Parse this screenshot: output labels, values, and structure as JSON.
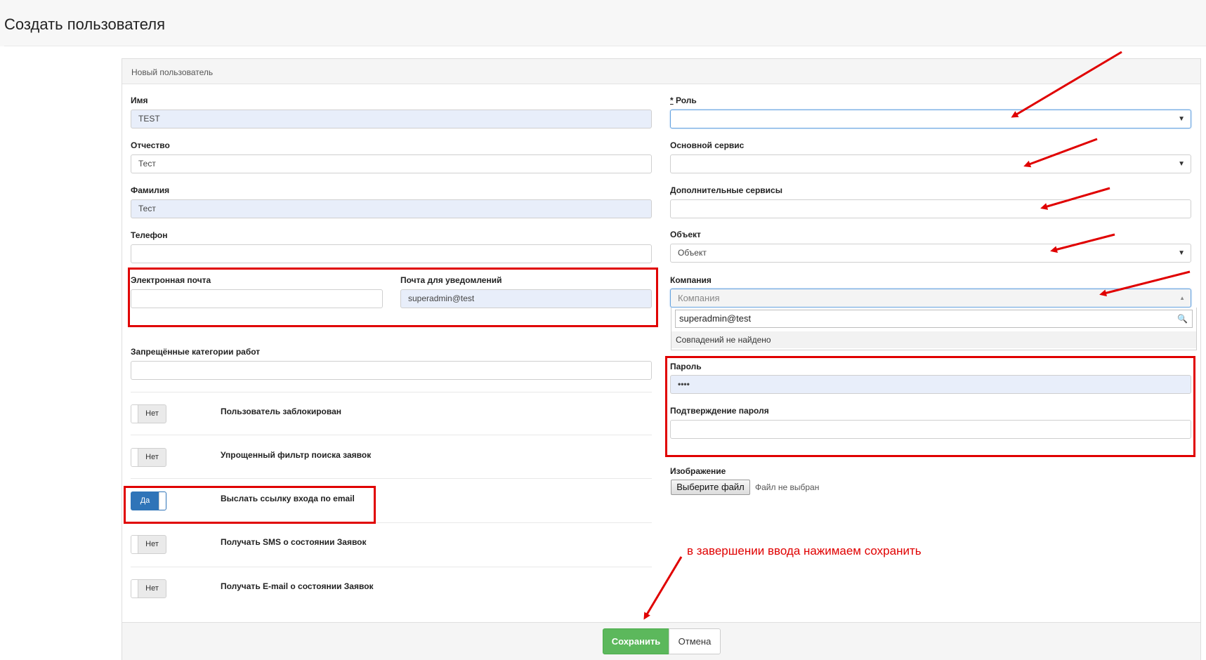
{
  "page": {
    "title": "Создать пользователя"
  },
  "panel": {
    "heading": "Новый пользователь"
  },
  "left": {
    "first_name": {
      "label": "Имя",
      "value": "TEST"
    },
    "middle_name": {
      "label": "Отчество",
      "value": "Тест"
    },
    "last_name": {
      "label": "Фамилия",
      "value": "Тест"
    },
    "phone": {
      "label": "Телефон",
      "value": ""
    },
    "email": {
      "label": "Электронная почта",
      "value": ""
    },
    "notify_email": {
      "label": "Почта для уведомлений",
      "value": "superadmin@test"
    },
    "forbidden_categories": {
      "label": "Запрещённые категории работ",
      "value": ""
    }
  },
  "toggles": [
    {
      "state": "Нет",
      "on": false,
      "label": "Пользователь заблокирован"
    },
    {
      "state": "Нет",
      "on": false,
      "label": "Упрощенный фильтр поиска заявок"
    },
    {
      "state": "Да",
      "on": true,
      "label": "Выслать ссылку входа по email"
    },
    {
      "state": "Нет",
      "on": false,
      "label": "Получать SMS о состоянии Заявок"
    },
    {
      "state": "Нет",
      "on": false,
      "label": "Получать E-mail о состоянии Заявок"
    }
  ],
  "right": {
    "role": {
      "required_mark": "*",
      "label": "Роль",
      "value": ""
    },
    "main_service": {
      "label": "Основной сервис",
      "value": ""
    },
    "extra_services": {
      "label": "Дополнительные сервисы",
      "value": ""
    },
    "object": {
      "label": "Объект",
      "placeholder": "Объект"
    },
    "company": {
      "label": "Компания",
      "placeholder": "Компания",
      "search_value": "superadmin@test",
      "no_results": "Совпадений не найдено"
    },
    "password": {
      "label": "Пароль",
      "value": "••••"
    },
    "password_confirm": {
      "label": "Подтверждение пароля",
      "value": ""
    },
    "image": {
      "label": "Изображение",
      "button": "Выберите файл",
      "status": "Файл не выбран"
    }
  },
  "icons": {
    "caret": "▼",
    "caret_up": "▲",
    "search": "🔍"
  },
  "annotation": {
    "text": "в завершении ввода нажимаем сохранить",
    "color": "#e00000"
  },
  "footer": {
    "save": "Сохранить",
    "cancel": "Отмена"
  },
  "colors": {
    "save_green": "#5cb85c",
    "toggle_blue": "#2f74b8",
    "filled_bg": "#e8eefa"
  }
}
